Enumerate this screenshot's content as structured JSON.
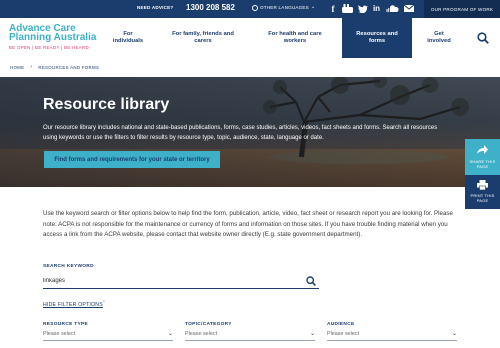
{
  "topbar": {
    "advice_label": "NEED ADVICE?",
    "phone": "1300 208 582",
    "language_label": "OTHER LANGUAGES",
    "program_label": "OUR PROGRAM OF WORK",
    "social_icons": [
      "facebook-icon",
      "youtube-icon",
      "twitter-icon",
      "linkedin-icon",
      "soundcloud-icon",
      "email-icon"
    ]
  },
  "logo": {
    "line1": "Advance Care",
    "line2": "Planning Australia",
    "tagline": "BE OPEN | BE READY | BE HEARD"
  },
  "nav": {
    "items": [
      {
        "line1": "For",
        "line2": "individuals"
      },
      {
        "line1": "For family, friends and",
        "line2": "carers"
      },
      {
        "line1": "For health and care",
        "line2": "workers"
      },
      {
        "line1": "Resources and",
        "line2": "forms"
      },
      {
        "line1": "Get",
        "line2": "involved"
      }
    ],
    "active_index": 3
  },
  "breadcrumb": {
    "home": "HOME",
    "current": "RESOURCES AND FORMS"
  },
  "hero": {
    "title": "Resource library",
    "description": "Our resource library includes national and state-based publications, forms, case studies, articles, videos, fact sheets and forms. Search all resources using keywords or use the filters to filter results by resource type, topic, audience, state, language or date.",
    "button_label": "Find forms and requirements for your state or territory"
  },
  "side_tabs": {
    "share_label_1": "SHARE THIS",
    "share_label_2": "PAGE",
    "print_label_1": "PRINT THIS",
    "print_label_2": "PAGE"
  },
  "intro": "Use the keyword search or filter options below to help find the form, publication, article, video, fact sheet or research report you are looking for. Please note: ACPA is not responsible for the maintenance or currency of forms and information on those sites. If you have trouble finding material when you access a link from the ACPA website, please contact that website owner directly (E.g. state government department).",
  "search": {
    "label": "SEARCH KEYWORD",
    "value": "linkages"
  },
  "filters": {
    "toggle_label": "HIDE FILTER OPTIONS",
    "items": [
      {
        "label": "RESOURCE TYPE",
        "selected": "Please select"
      },
      {
        "label": "TOPIC/CATEGORY",
        "selected": "Please select"
      },
      {
        "label": "AUDIENCE",
        "selected": "Please select"
      }
    ]
  },
  "colors": {
    "navy": "#1b3d6e",
    "teal": "#3eb1c8",
    "pink": "#e0397a"
  }
}
